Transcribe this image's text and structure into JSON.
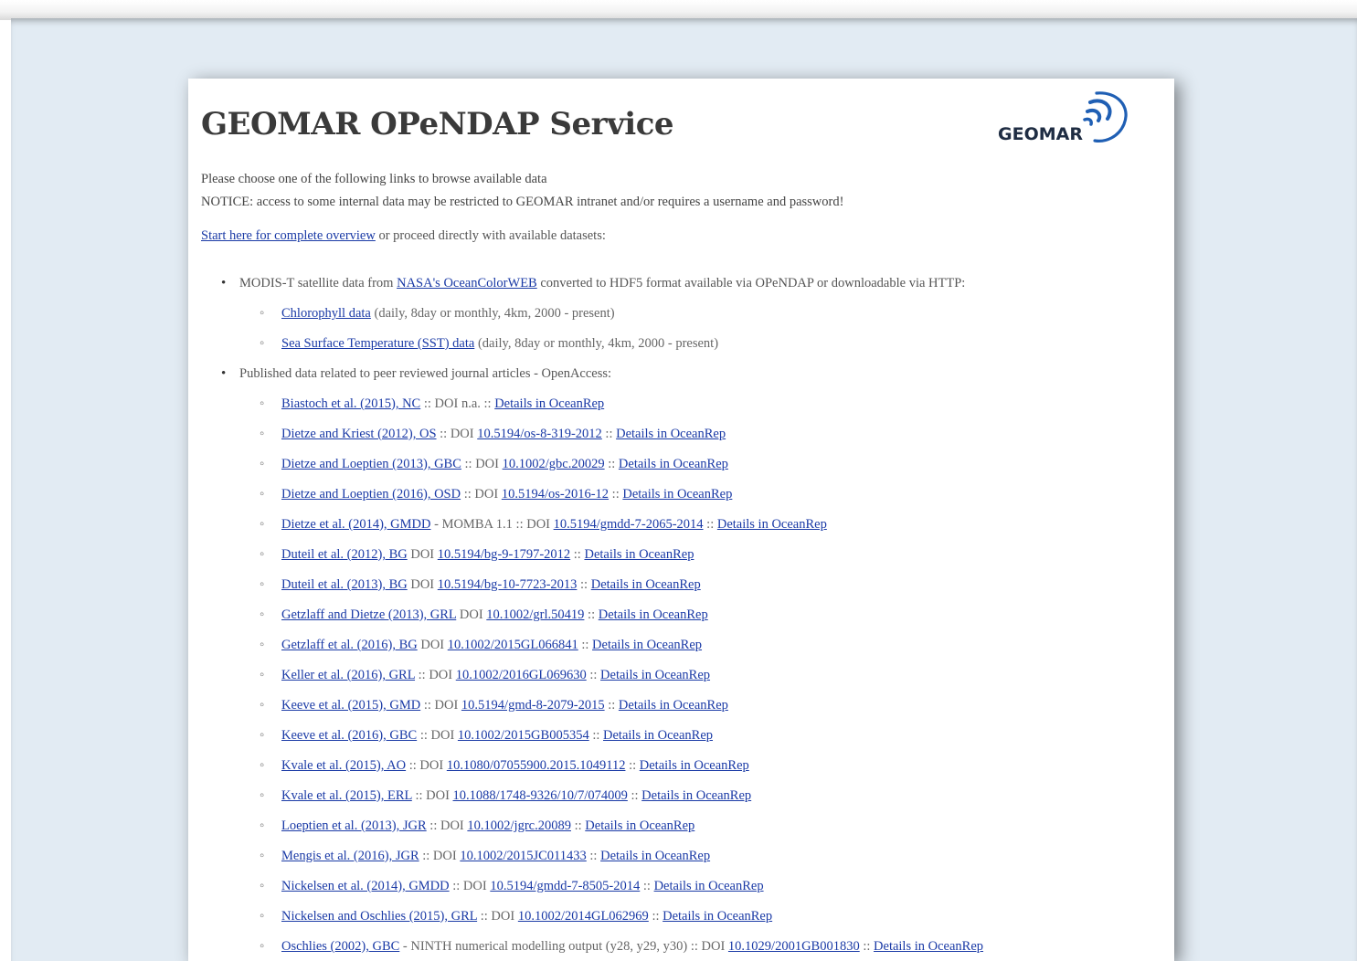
{
  "page": {
    "title": "GEOMAR OPeNDAP Service",
    "logo_text": "GEOMAR",
    "intro_line1": "Please choose one of the following links to browse available data",
    "intro_line2": "NOTICE: access to some internal data may be restricted to GEOMAR intranet and/or requires a username and password!",
    "start_link": "Start here for complete overview",
    "start_rest": " or proceed directly with available datasets:"
  },
  "modis": {
    "prefix": "MODIS-T satellite data from ",
    "link": "NASA's OceanColorWEB",
    "suffix": " converted to HDF5 format available via OPeNDAP or downloadable via HTTP:",
    "items": [
      {
        "link": "Chlorophyll data",
        "note": " (daily, 8day or monthly, 4km, 2000 - present)"
      },
      {
        "link": "Sea Surface Temperature (SST) data",
        "note": " (daily, 8day or monthly, 4km, 2000 - present)"
      }
    ]
  },
  "published": {
    "heading": "Published data related to peer reviewed journal articles - OpenAccess:",
    "details_label": "Details in OceanRep",
    "items": [
      {
        "ref": "Biastoch et al. (2015), NC",
        "mid": " :: DOI n.a. :: ",
        "doi": ""
      },
      {
        "ref": "Dietze and Kriest (2012), OS",
        "mid": " :: DOI ",
        "doi": "10.5194/os-8-319-2012"
      },
      {
        "ref": "Dietze and Loeptien (2013), GBC",
        "mid": " :: DOI ",
        "doi": "10.1002/gbc.20029"
      },
      {
        "ref": "Dietze and Loeptien (2016), OSD",
        "mid": " :: DOI ",
        "doi": "10.5194/os-2016-12"
      },
      {
        "ref": "Dietze et al. (2014), GMDD",
        "mid": " - MOMBA 1.1 :: DOI ",
        "doi": "10.5194/gmdd-7-2065-2014"
      },
      {
        "ref": "Duteil et al. (2012), BG",
        "mid": " DOI ",
        "doi": "10.5194/bg-9-1797-2012"
      },
      {
        "ref": "Duteil et al. (2013), BG",
        "mid": " DOI ",
        "doi": "10.5194/bg-10-7723-2013"
      },
      {
        "ref": "Getzlaff and Dietze (2013), GRL",
        "mid": " DOI ",
        "doi": "10.1002/grl.50419"
      },
      {
        "ref": "Getzlaff et al. (2016), BG",
        "mid": " DOI ",
        "doi": "10.1002/2015GL066841"
      },
      {
        "ref": "Keller et al. (2016), GRL",
        "mid": " :: DOI ",
        "doi": "10.1002/2016GL069630"
      },
      {
        "ref": "Keeve et al. (2015), GMD",
        "mid": " :: DOI ",
        "doi": "10.5194/gmd-8-2079-2015"
      },
      {
        "ref": "Keeve et al. (2016), GBC",
        "mid": " :: DOI ",
        "doi": "10.1002/2015GB005354"
      },
      {
        "ref": "Kvale et al. (2015), AO",
        "mid": " :: DOI ",
        "doi": "10.1080/07055900.2015.1049112"
      },
      {
        "ref": "Kvale et al. (2015), ERL",
        "mid": " :: DOI ",
        "doi": "10.1088/1748-9326/10/7/074009"
      },
      {
        "ref": "Loeptien et al. (2013), JGR",
        "mid": " :: DOI ",
        "doi": "10.1002/jgrc.20089"
      },
      {
        "ref": "Mengis et al. (2016), JGR",
        "mid": " :: DOI ",
        "doi": "10.1002/2015JC011433"
      },
      {
        "ref": "Nickelsen et al. (2014), GMDD",
        "mid": " :: DOI ",
        "doi": "10.5194/gmdd-7-8505-2014"
      },
      {
        "ref": "Nickelsen and Oschlies (2015), GRL",
        "mid": " :: DOI ",
        "doi": "10.1002/2014GL062969"
      },
      {
        "ref": "Oschlies (2002), GBC",
        "mid": " - NINTH numerical modelling output (y28, y29, y30) :: DOI ",
        "doi": "10.1029/2001GB001830"
      }
    ]
  },
  "colors": {
    "link": "#1a3aa6",
    "backdrop": "#e2ebf3",
    "logo_swoosh": "#1f5fb4"
  }
}
